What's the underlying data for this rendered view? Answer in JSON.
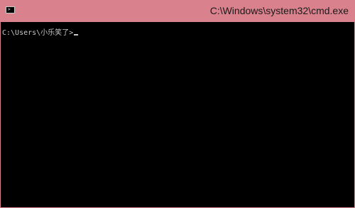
{
  "window": {
    "title": "C:\\Windows\\system32\\cmd.exe",
    "icon": "console-icon",
    "titlebar_color": "#d9818c"
  },
  "console": {
    "prompt": "C:\\Users\\小乐笑了>",
    "text_color": "#c8c8c8",
    "background_color": "#000000"
  }
}
